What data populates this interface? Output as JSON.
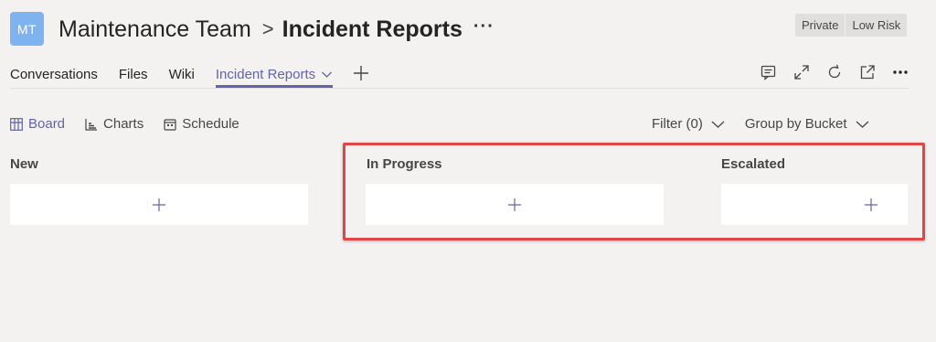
{
  "header": {
    "avatar_initials": "MT",
    "team_name": "Maintenance Team",
    "separator": ">",
    "channel_name": "Incident Reports",
    "more": "···"
  },
  "badges": {
    "privacy": "Private",
    "risk": "Low Risk"
  },
  "tabs": [
    {
      "label": "Conversations"
    },
    {
      "label": "Files"
    },
    {
      "label": "Wiki"
    },
    {
      "label": "Incident Reports",
      "active": true
    }
  ],
  "toolbar_icons": [
    "conversation-icon",
    "expand-icon",
    "refresh-icon",
    "popout-icon",
    "more-icon"
  ],
  "views": [
    {
      "label": "Board",
      "active": true
    },
    {
      "label": "Charts"
    },
    {
      "label": "Schedule"
    }
  ],
  "filters": {
    "filter_label": "Filter (0)",
    "group_label": "Group by Bucket"
  },
  "buckets": [
    {
      "name": "New"
    },
    {
      "name": "In Progress"
    },
    {
      "name": "Escalated"
    }
  ],
  "colors": {
    "accent": "#6264a7",
    "highlight": "#e04646",
    "background": "#f3f2f1",
    "avatar": "#7eb3f0"
  }
}
